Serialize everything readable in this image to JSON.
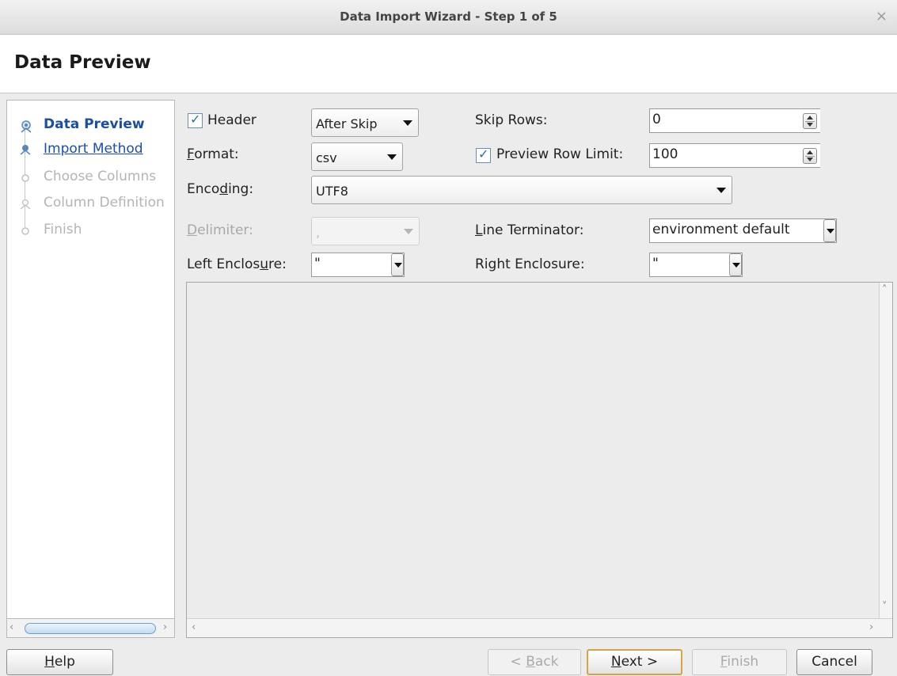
{
  "window": {
    "title": "Data Import Wizard - Step 1 of 5",
    "close_glyph": "×"
  },
  "header": {
    "title": "Data Preview"
  },
  "steps": [
    {
      "label": "Data Preview",
      "state": "current"
    },
    {
      "label": "Import Method",
      "state": "link"
    },
    {
      "label": "Choose Columns",
      "state": "disabled"
    },
    {
      "label": "Column Definition",
      "state": "disabled"
    },
    {
      "label": "Finish",
      "state": "disabled"
    }
  ],
  "form": {
    "header_checkbox": {
      "label": "Header",
      "checked": true
    },
    "header_mode": {
      "value": "After Skip"
    },
    "skip_rows": {
      "label": "Skip Rows:",
      "value": "0"
    },
    "format": {
      "label_pre": "",
      "label_u": "F",
      "label_post": "ormat:",
      "value": "csv"
    },
    "preview_limit": {
      "label": "Preview Row Limit:",
      "checked": true,
      "value": "100"
    },
    "encoding": {
      "label_pre": "Enco",
      "label_u": "d",
      "label_post": "ing:",
      "value": "UTF8"
    },
    "delimiter": {
      "label_pre": "",
      "label_u": "D",
      "label_post": "elimiter:",
      "value": ","
    },
    "line_terminator": {
      "label_pre": "",
      "label_u": "L",
      "label_post": "ine Terminator:",
      "value": "environment default"
    },
    "left_enclosure": {
      "label_pre": "Left Enclos",
      "label_u": "u",
      "label_post": "re:",
      "value": "\""
    },
    "right_enclosure": {
      "label": "Right Enclosure:",
      "value": "\""
    }
  },
  "buttons": {
    "help": {
      "pre": "",
      "u": "H",
      "post": "elp"
    },
    "back": {
      "pre": "< ",
      "u": "B",
      "post": "ack"
    },
    "next": {
      "pre": "",
      "u": "N",
      "post": "ext >"
    },
    "finish": {
      "pre": "",
      "u": "F",
      "post": "inish"
    },
    "cancel": {
      "label": "Cancel"
    }
  },
  "colors": {
    "link": "#1a4fb0",
    "current_step": "#1a4fa0",
    "default_button_border": "#d4a544"
  },
  "icons": {
    "check": "✓",
    "scroll_left": "‹",
    "scroll_right": "›",
    "scroll_up": "˄",
    "scroll_down": "˅"
  }
}
